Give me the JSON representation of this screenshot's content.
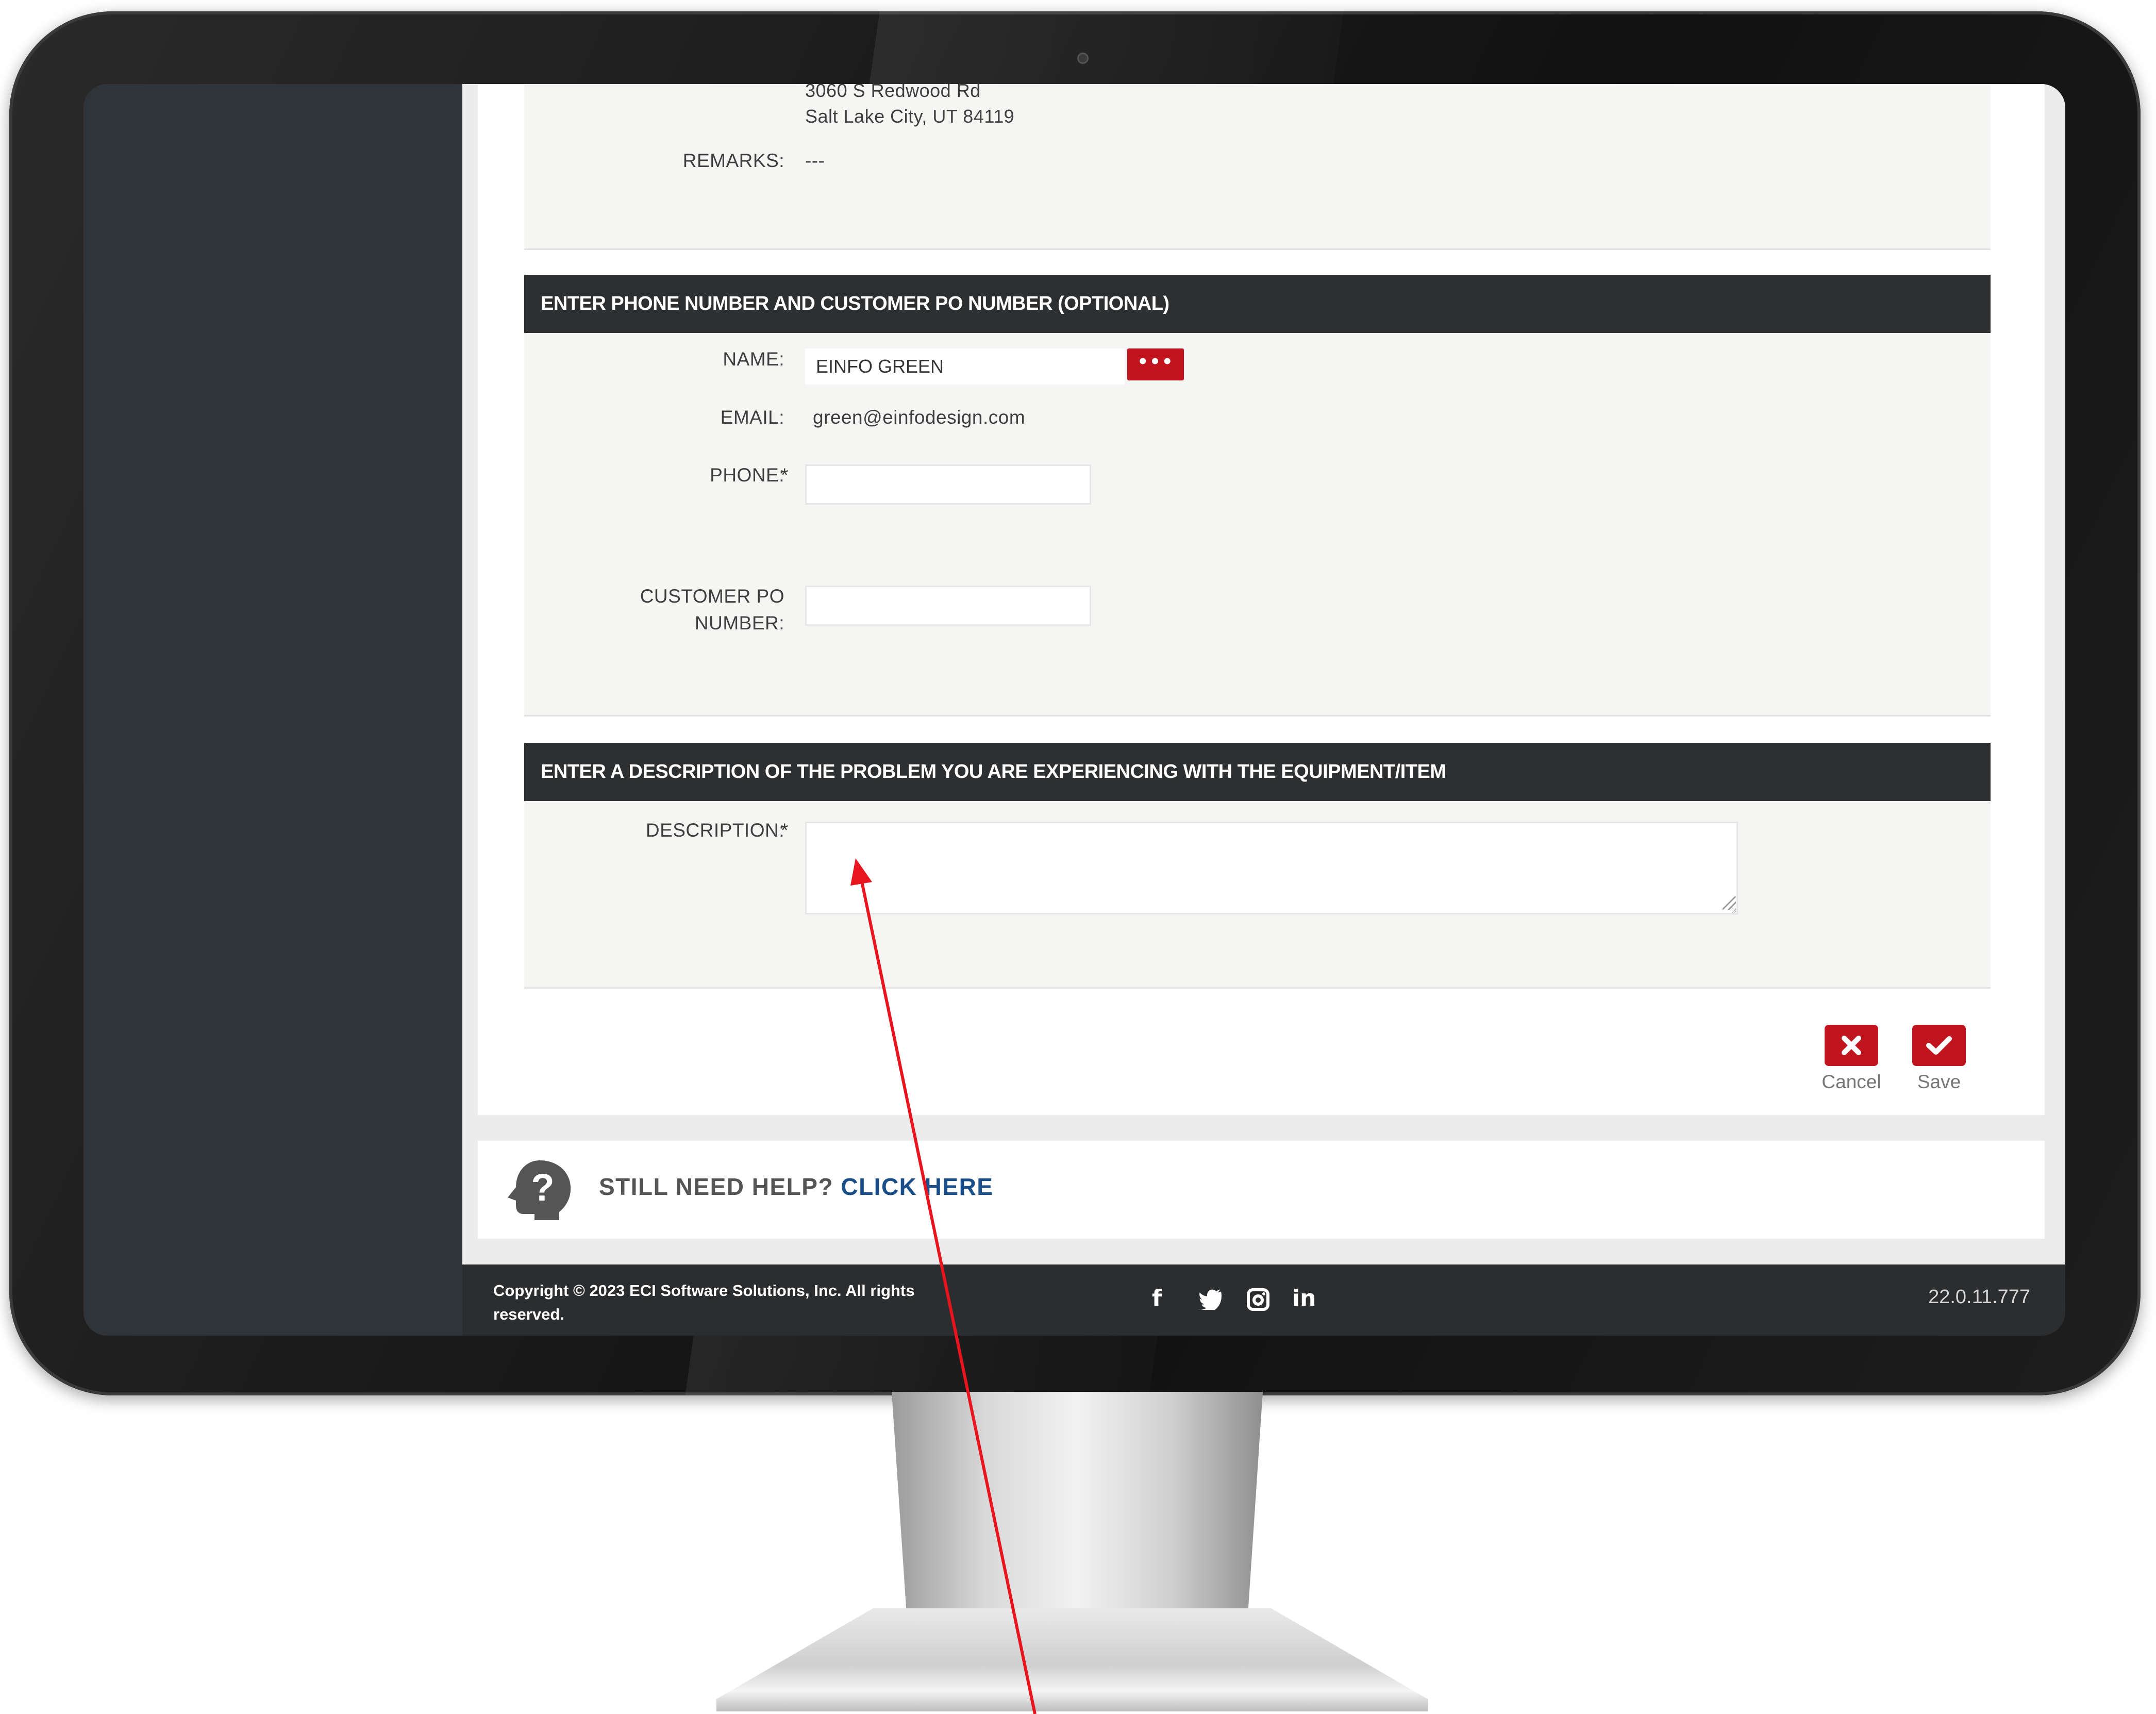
{
  "address": {
    "street": "3060 S Redwood Rd",
    "city_line": "Salt Lake City, UT 84119"
  },
  "remarks": {
    "label": "REMARKS:",
    "value": "---"
  },
  "contact_section": {
    "header": "ENTER PHONE NUMBER AND CUSTOMER PO NUMBER (OPTIONAL)",
    "name_label": "NAME:",
    "name_value": "EINFO GREEN",
    "more_button": "•••",
    "email_label": "EMAIL:",
    "email_value": "green@einfodesign.com",
    "phone_label": "PHONE:",
    "phone_value": "",
    "required_mark": "*",
    "po_label_line1": "CUSTOMER PO",
    "po_label_line2": "NUMBER:",
    "po_value": ""
  },
  "description_section": {
    "header": "ENTER A DESCRIPTION OF THE PROBLEM YOU ARE EXPERIENCING WITH THE EQUIPMENT/ITEM",
    "label": "DESCRIPTION:",
    "required_mark": "*",
    "value": ""
  },
  "actions": {
    "cancel_label": "Cancel",
    "save_label": "Save"
  },
  "help": {
    "prefix": "STILL NEED HELP?",
    "link": "CLICK HERE"
  },
  "footer": {
    "copyright_line1": "Copyright © 2023 ECI Software Solutions, Inc. All rights",
    "copyright_line2": "reserved.",
    "social_icons": [
      "facebook-icon",
      "twitter-icon",
      "instagram-icon",
      "linkedin-icon"
    ],
    "facebook_glyph": "f",
    "linkedin_glyph": "in",
    "version": "22.0.11.777"
  },
  "colors": {
    "accent_red": "#c0141e",
    "header_dark": "#2d2f31",
    "link_blue": "#1a4e8a",
    "annotation_arrow": "#e8141e"
  }
}
